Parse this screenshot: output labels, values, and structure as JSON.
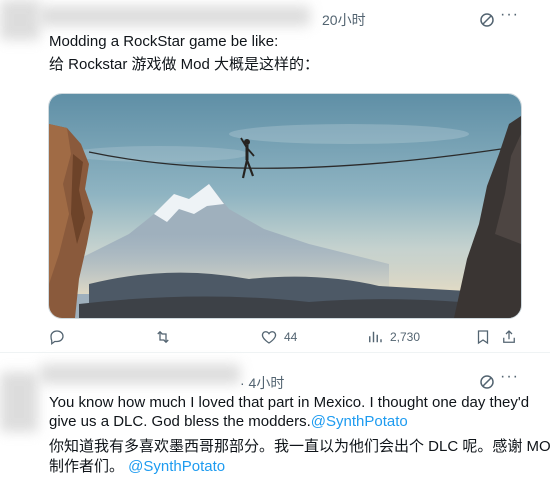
{
  "tweet1": {
    "time": "20小时",
    "text_en": "Modding a RockStar game be like:",
    "text_zh": "给 Rockstar 游戏做 Mod 大概是这样的：",
    "actions": {
      "reply": "",
      "retweet": "",
      "like": "44",
      "views": "2,730"
    }
  },
  "tweet2": {
    "time": "· 4小时",
    "line1": "You know how much I loved that part in Mexico. I thought one day they'd",
    "line2_prefix": "give us a DLC. God bless the modders.",
    "mention": "@SynthPotato",
    "zh_line1": "你知道我有多喜欢墨西哥那部分。我一直以为他们会出个 DLC 呢。感谢 MOD",
    "zh_line2_prefix": "制作者们。 ",
    "zh_mention": "@SynthPotato"
  },
  "colors": {
    "accent": "#1d9bf0",
    "muted": "#536471"
  }
}
